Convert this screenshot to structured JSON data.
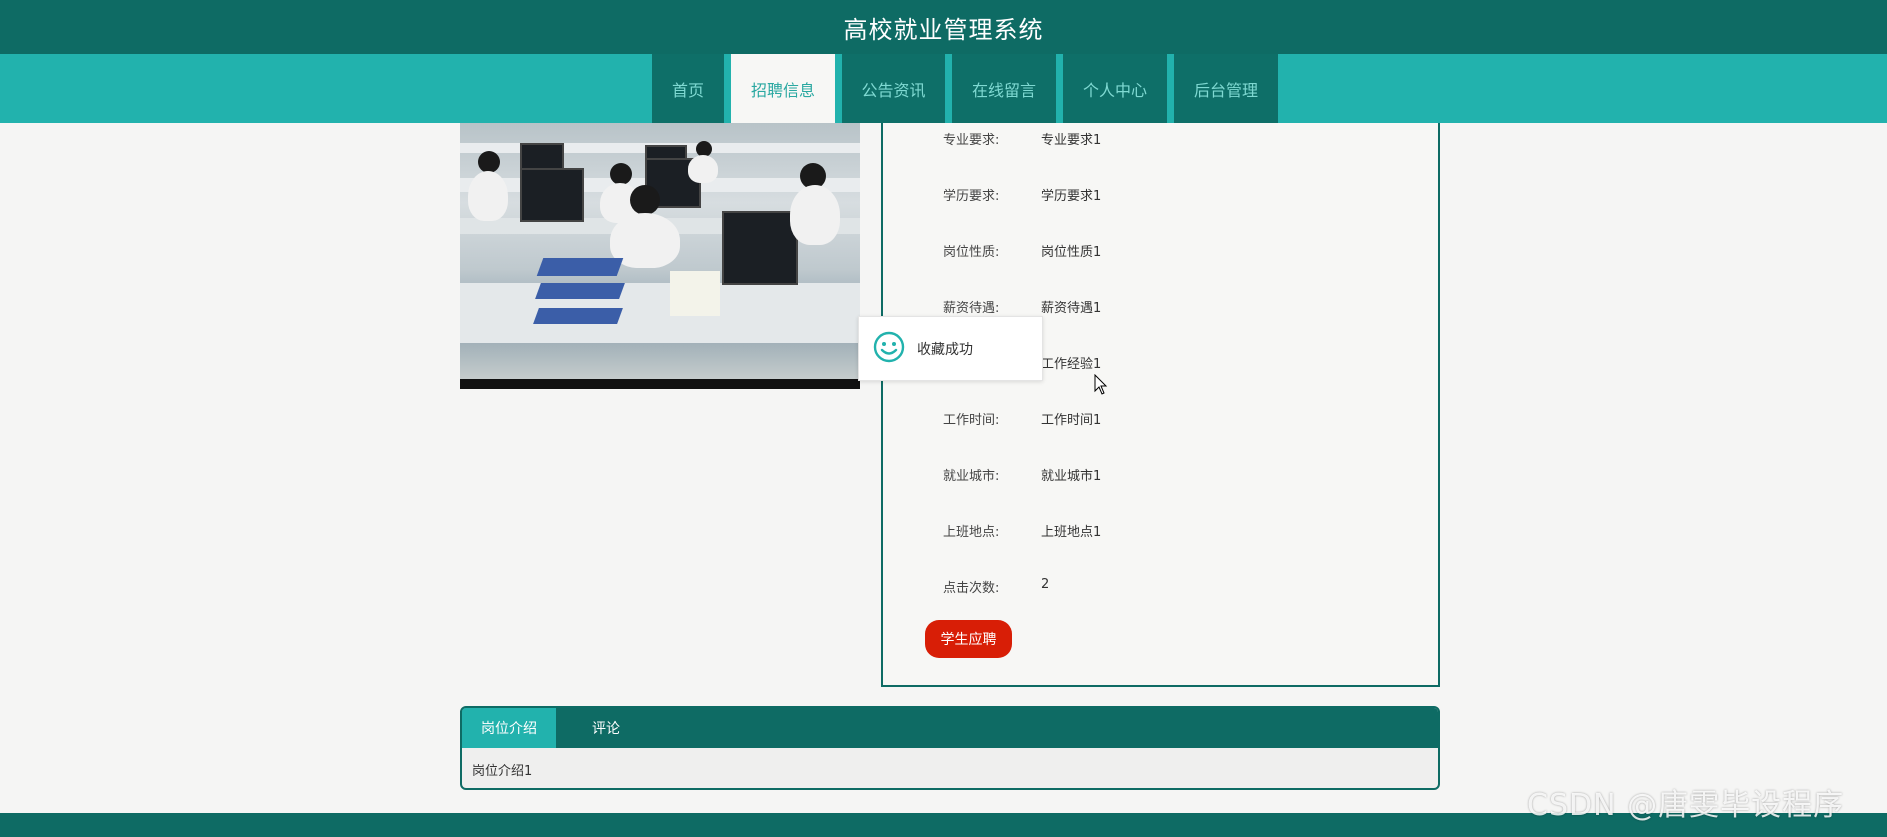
{
  "header": {
    "title": "高校就业管理系统"
  },
  "nav": {
    "items": [
      {
        "label": "首页"
      },
      {
        "label": "招聘信息"
      },
      {
        "label": "公告资讯"
      },
      {
        "label": "在线留言"
      },
      {
        "label": "个人中心"
      },
      {
        "label": "后台管理"
      }
    ],
    "active": "招聘信息"
  },
  "job": {
    "fields": [
      {
        "label": "专业要求:",
        "value": "专业要求1"
      },
      {
        "label": "学历要求:",
        "value": "学历要求1"
      },
      {
        "label": "岗位性质:",
        "value": "岗位性质1"
      },
      {
        "label": "薪资待遇:",
        "value": "薪资待遇1"
      },
      {
        "label": "",
        "value": "工作经验1"
      },
      {
        "label": "工作时间:",
        "value": "工作时间1"
      },
      {
        "label": "就业城市:",
        "value": "就业城市1"
      },
      {
        "label": "上班地点:",
        "value": "上班地点1"
      },
      {
        "label": "点击次数:",
        "value": "2"
      }
    ],
    "apply_label": "学生应聘"
  },
  "toast": {
    "message": "收藏成功",
    "icon": "smile-icon",
    "color": "#22b2ad"
  },
  "tabs": {
    "items": [
      {
        "label": "岗位介绍"
      },
      {
        "label": "评论"
      }
    ],
    "content": "岗位介绍1"
  },
  "watermark": "CSDN @唐雯毕设程序",
  "colors": {
    "primary": "#0e6b64",
    "accent": "#22b2ad",
    "danger": "#d81e06"
  }
}
